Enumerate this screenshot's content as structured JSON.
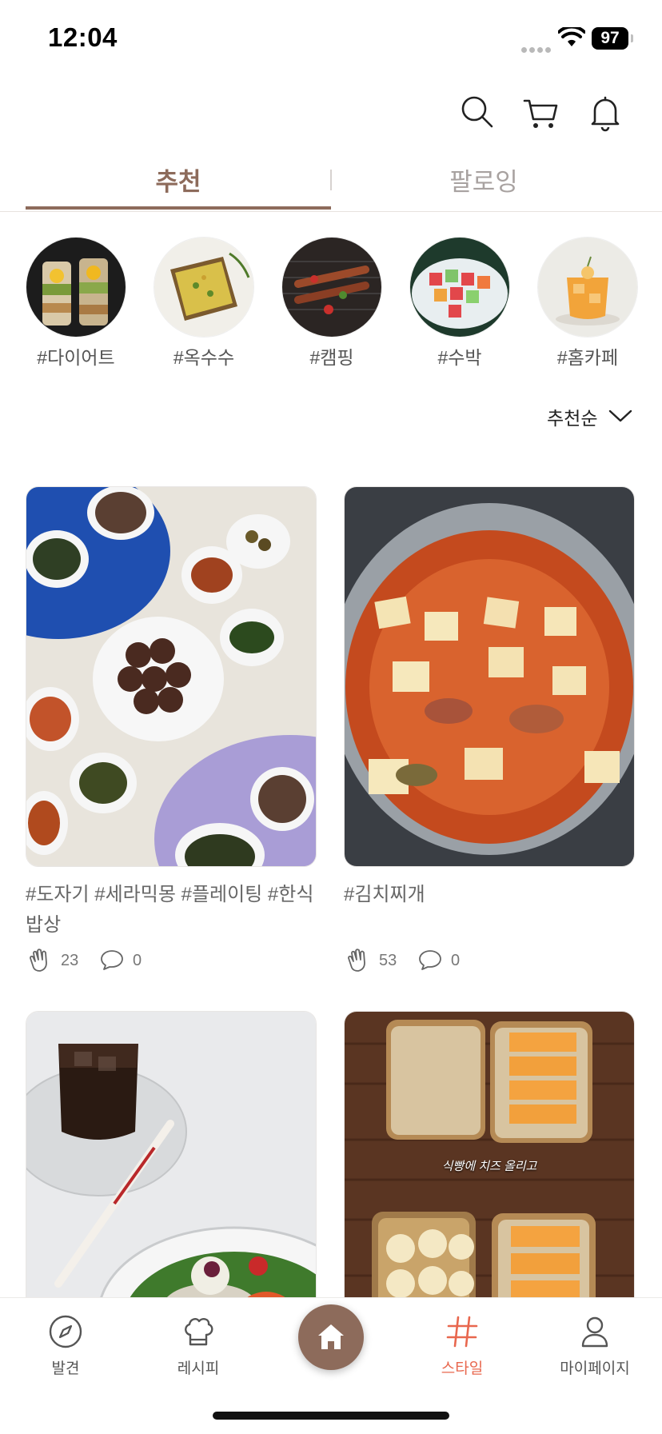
{
  "status_bar": {
    "time": "12:04",
    "battery": "97"
  },
  "header": {
    "icons": [
      "search-icon",
      "cart-icon",
      "bell-icon"
    ]
  },
  "tabs": [
    {
      "label": "추천",
      "active": true
    },
    {
      "label": "팔로잉",
      "active": false
    }
  ],
  "tags": [
    {
      "label": "#다이어트"
    },
    {
      "label": "#옥수수"
    },
    {
      "label": "#캠핑"
    },
    {
      "label": "#수박"
    },
    {
      "label": "#홈카페"
    }
  ],
  "sort": {
    "label": "추천순"
  },
  "posts": [
    {
      "caption": "#도자기 #세라믹몽 #플레이팅 #한식밥상",
      "claps": "23",
      "comments": "0"
    },
    {
      "caption": "#김치찌개",
      "claps": "53",
      "comments": "0"
    },
    {
      "caption": "",
      "claps": "",
      "comments": ""
    },
    {
      "caption": "",
      "photo_text": "식빵에 치즈 올리고",
      "claps": "",
      "comments": ""
    }
  ],
  "bottom_nav": [
    {
      "label": "발견",
      "icon": "compass-icon"
    },
    {
      "label": "레시피",
      "icon": "chef-hat-icon"
    },
    {
      "label": "",
      "icon": "home-icon"
    },
    {
      "label": "스타일",
      "icon": "hash-icon",
      "active": true
    },
    {
      "label": "마이페이지",
      "icon": "person-icon"
    }
  ],
  "colors": {
    "accent": "#8d6b5b",
    "active_nav": "#e8674e"
  }
}
